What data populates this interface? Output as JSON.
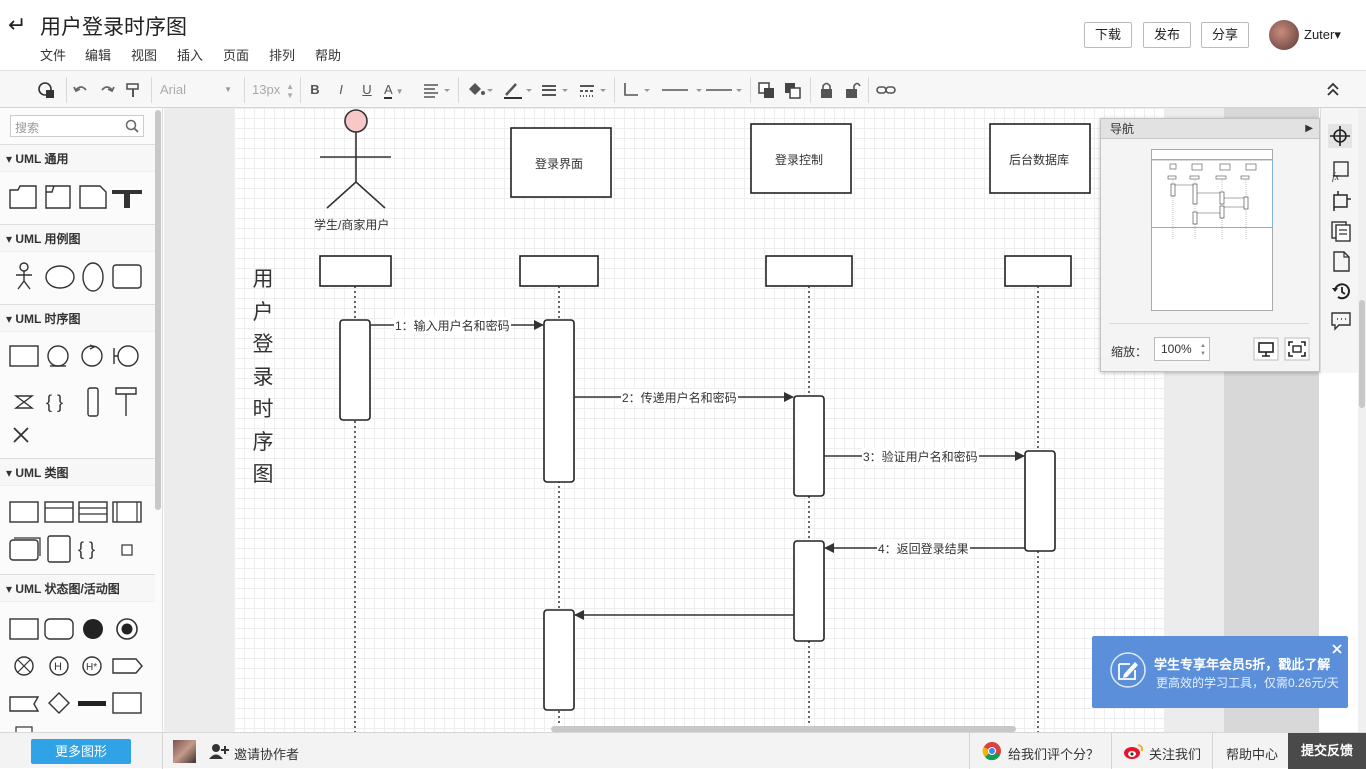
{
  "header": {
    "back_icon": "arrow-left-icon",
    "title": "用户登录时序图",
    "menu": [
      "文件",
      "编辑",
      "视图",
      "插入",
      "页面",
      "排列",
      "帮助"
    ],
    "buttons": {
      "download": "下载",
      "publish": "发布",
      "share": "分享"
    },
    "user": {
      "name": "Zuter",
      "caret": "▾"
    }
  },
  "toolbar": {
    "font_family": "Arial",
    "font_size": "13px",
    "bold": "B",
    "italic": "I",
    "underline": "U",
    "font_color": "A"
  },
  "sidebar": {
    "search_placeholder": "搜索",
    "categories": [
      {
        "label": "UML 通用"
      },
      {
        "label": "UML 用例图"
      },
      {
        "label": "UML 时序图"
      },
      {
        "label": "UML 类图"
      },
      {
        "label": "UML 状态图/活动图"
      }
    ]
  },
  "diagram": {
    "side_title": [
      "用",
      "户",
      "登",
      "录",
      "时",
      "序",
      "图"
    ],
    "actor_label": "学生/商家用户",
    "objects": [
      "登录界面",
      "登录控制",
      "后台数据库"
    ],
    "messages": [
      "1：输入用户名和密码",
      "2：传递用户名和密码",
      "3：验证用户名和密码",
      "4：返回登录结果"
    ]
  },
  "navigator": {
    "title": "导航",
    "zoom_label": "缩放：",
    "zoom_value": "100%"
  },
  "promo": {
    "title": "学生专享年会员5折，戳此了解",
    "subtitle": "更高效的学习工具，仅需0.26元/天"
  },
  "bottom": {
    "more_shapes": "更多图形",
    "invite": "邀请协作者",
    "rate": "给我们评个分？",
    "follow": "关注我们",
    "help": "帮助中心",
    "feedback": "提交反馈"
  },
  "colors": {
    "accent": "#2fa3e6",
    "promo": "#5b8fd9",
    "actor_head": "#f8c8c8",
    "feedback_bg": "#4a4a4a"
  }
}
